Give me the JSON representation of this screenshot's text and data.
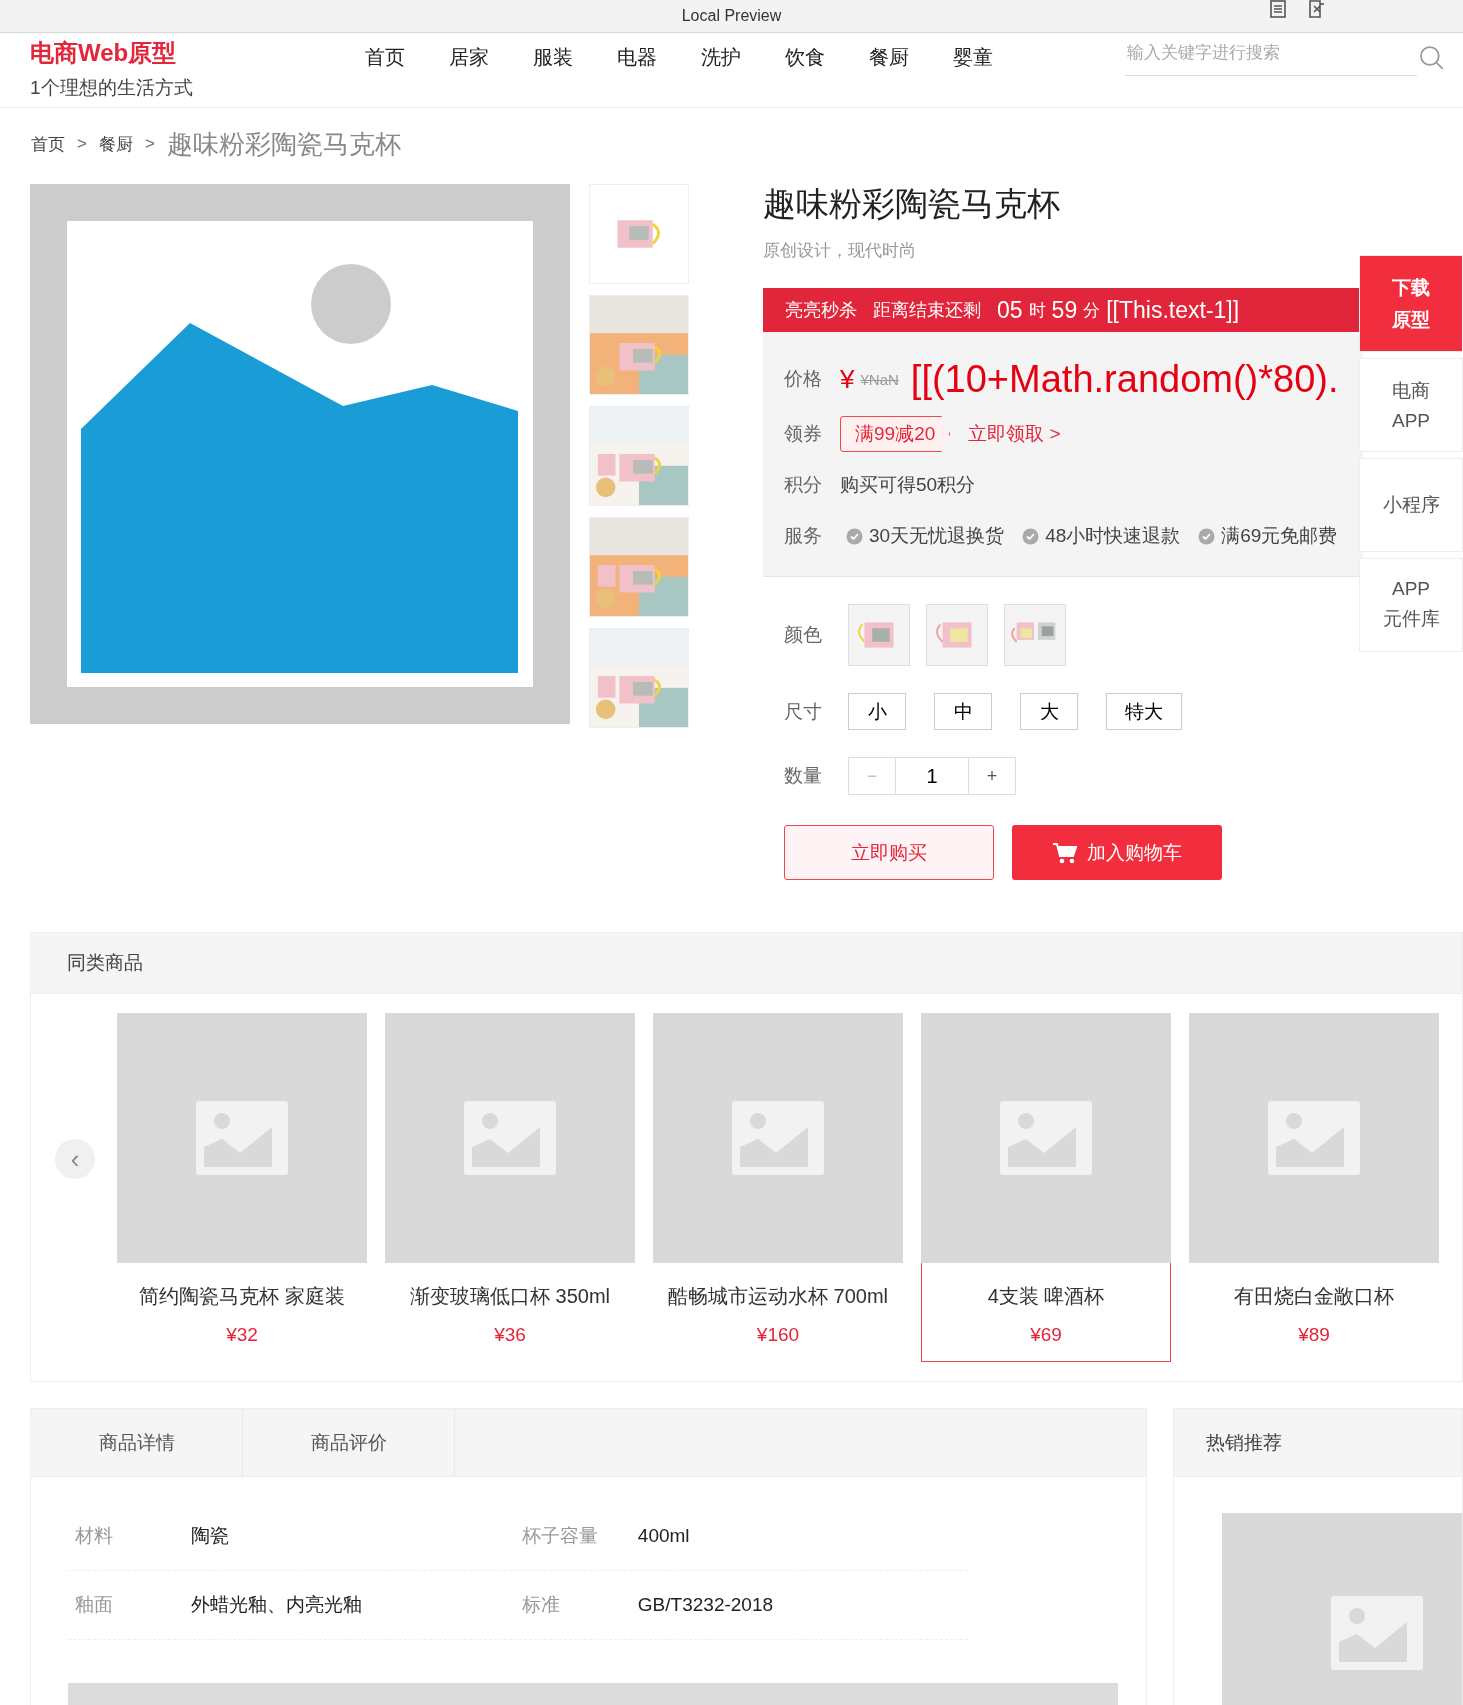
{
  "window": {
    "title": "Local Preview"
  },
  "header": {
    "logo": "电商Web原型",
    "tagline": "1个理想的生活方式",
    "nav": [
      "首页",
      "居家",
      "服装",
      "电器",
      "洗护",
      "饮食",
      "餐厨",
      "婴童"
    ],
    "search": {
      "placeholder": "输入关键字进行搜索"
    }
  },
  "breadcrumb": [
    {
      "label": "首页",
      "kind": "link"
    },
    {
      "label": ">",
      "kind": "separator"
    },
    {
      "label": "餐厨",
      "kind": "link"
    },
    {
      "label": ">",
      "kind": "separator"
    },
    {
      "label": "趣味粉彩陶瓷马克杯",
      "kind": "current"
    }
  ],
  "gallery": {
    "thumbnails": [
      {
        "kind": "picture"
      },
      {
        "kind": "picture"
      },
      {
        "kind": "picture"
      },
      {
        "kind": "picture"
      },
      {
        "kind": "picture"
      }
    ]
  },
  "product": {
    "title": "趣味粉彩陶瓷马克杯",
    "subtitle": "原创设计，现代时尚",
    "flash": {
      "label": "亮亮秒杀",
      "countdown_label": "距离结束还剩",
      "hours": "05",
      "h_unit": "时",
      "minutes": "59",
      "m_unit": "分",
      "seconds": "[[This.text-1]]"
    },
    "price_label": "价格",
    "currency": "¥",
    "price": "[[(10+Math.random()*80).",
    "original_price": "¥NaN",
    "coupon_label": "领券",
    "coupon": "满99减20",
    "coupon_link": "立即领取 >",
    "points_label": "积分",
    "points": "购买可得50积分",
    "service_label": "服务",
    "services": [
      "30天无忧退换货",
      "48小时快速退款",
      "满69元免邮费"
    ],
    "color_label": "颜色",
    "colors": [
      {
        "kind": "picture",
        "selected": false
      },
      {
        "kind": "picture",
        "selected": false
      },
      {
        "kind": "picture",
        "selected": false
      }
    ],
    "size_label": "尺寸",
    "sizes": [
      {
        "label": "小",
        "selected": false
      },
      {
        "label": "中",
        "selected": false
      },
      {
        "label": "大",
        "selected": false
      },
      {
        "label": "特大",
        "selected": false
      }
    ],
    "quantity_label": "数量",
    "minus": "−",
    "quantity": "1",
    "plus": "+",
    "buy": "立即购买",
    "cart": "加入购物车"
  },
  "side_float": [
    {
      "lines": [
        "下载",
        "原型"
      ],
      "kind": "primary"
    },
    {
      "lines": [
        "电商",
        "APP"
      ],
      "kind": "plain"
    },
    {
      "lines": [
        "小程序"
      ],
      "kind": "plain"
    },
    {
      "lines": [
        "APP",
        "元件库"
      ],
      "kind": "plain"
    }
  ],
  "similar": {
    "title": "同类商品",
    "prev": "‹",
    "items": [
      {
        "name": "简约陶瓷马克杯 家庭装",
        "price": "¥32",
        "selected": false
      },
      {
        "name": "渐变玻璃低口杯 350ml",
        "price": "¥36",
        "selected": false
      },
      {
        "name": "酷畅城市运动水杯 700ml",
        "price": "¥160",
        "selected": false
      },
      {
        "name": "4支装 啤酒杯",
        "price": "¥69",
        "selected": true
      },
      {
        "name": "有田烧白金敞口杯",
        "price": "¥89",
        "selected": false
      }
    ]
  },
  "details": {
    "tabs": [
      {
        "label": "商品详情"
      },
      {
        "label": "商品评价"
      }
    ],
    "specs": [
      [
        {
          "label": "材料",
          "value": "陶瓷"
        },
        {
          "label": "杯子容量",
          "value": "400ml"
        }
      ],
      [
        {
          "label": "釉面",
          "value": "外蜡光釉、内亮光釉"
        },
        {
          "label": "标准",
          "value": "GB/T3232-2018"
        }
      ]
    ]
  },
  "hot": {
    "title": "热销推荐"
  }
}
